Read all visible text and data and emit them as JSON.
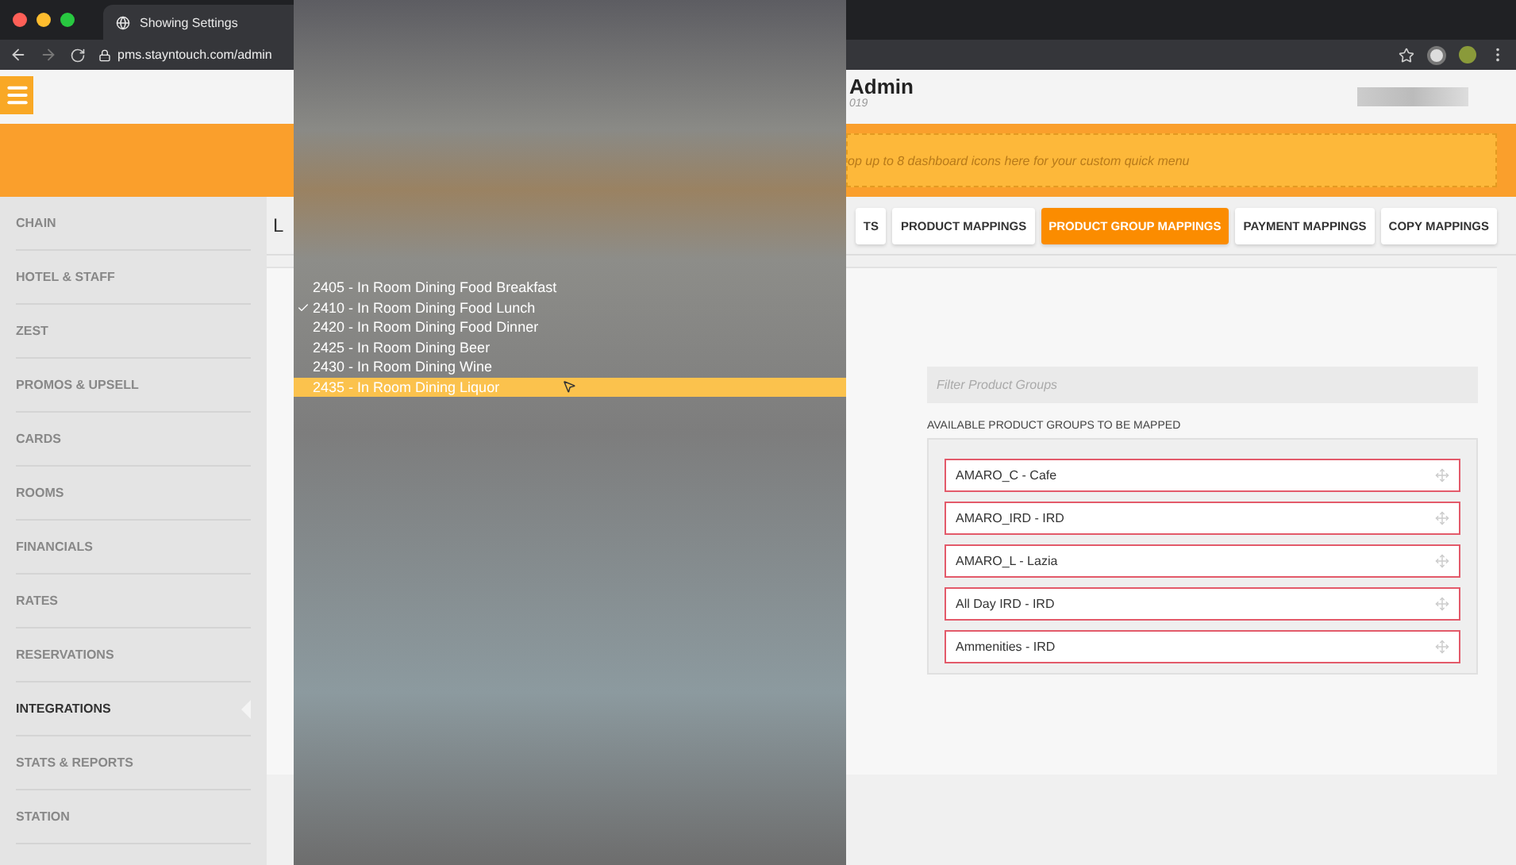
{
  "browser": {
    "tab_title": "Showing Settings",
    "url": "pms.stayntouch.com/admin"
  },
  "header": {
    "title": "Admin",
    "subtitle": "019"
  },
  "quick_menu": {
    "hint": "op up to 8 dashboard icons here for your custom quick menu"
  },
  "sidebar": {
    "items": [
      {
        "label": "CHAIN",
        "selected": false
      },
      {
        "label": "HOTEL & STAFF",
        "selected": false
      },
      {
        "label": "ZEST",
        "selected": false
      },
      {
        "label": "PROMOS & UPSELL",
        "selected": false
      },
      {
        "label": "CARDS",
        "selected": false
      },
      {
        "label": "ROOMS",
        "selected": false
      },
      {
        "label": "FINANCIALS",
        "selected": false
      },
      {
        "label": "RATES",
        "selected": false
      },
      {
        "label": "RESERVATIONS",
        "selected": false
      },
      {
        "label": "INTEGRATIONS",
        "selected": true
      },
      {
        "label": "STATS & REPORTS",
        "selected": false
      },
      {
        "label": "STATION",
        "selected": false
      }
    ]
  },
  "content": {
    "heading": "L",
    "tabs": [
      {
        "label": "TS",
        "selected": false
      },
      {
        "label": "PRODUCT MAPPINGS",
        "selected": false
      },
      {
        "label": "PRODUCT GROUP MAPPINGS",
        "selected": true
      },
      {
        "label": "PAYMENT MAPPINGS",
        "selected": false
      },
      {
        "label": "COPY MAPPINGS",
        "selected": false
      }
    ],
    "filter": {
      "placeholder": "Filter Product Groups"
    },
    "available_label": "AVAILABLE PRODUCT GROUPS TO BE MAPPED",
    "product_groups": [
      "AMARO_C - Cafe",
      "AMARO_IRD - IRD",
      "AMARO_L - Lazia",
      "All Day IRD - IRD",
      "Ammenities - IRD"
    ]
  },
  "dropdown": {
    "options": [
      {
        "label": "2405 - In Room Dining Food Breakfast",
        "checked": false,
        "selected": false
      },
      {
        "label": "2410 - In Room Dining Food Lunch",
        "checked": true,
        "selected": false
      },
      {
        "label": "2420 - In Room Dining Food Dinner",
        "checked": false,
        "selected": false
      },
      {
        "label": "2425 - In Room Dining Beer",
        "checked": false,
        "selected": false
      },
      {
        "label": "2430 - In Room Dining Wine",
        "checked": false,
        "selected": false
      },
      {
        "label": "2435 - In Room Dining Liquor",
        "checked": false,
        "selected": true
      }
    ]
  }
}
